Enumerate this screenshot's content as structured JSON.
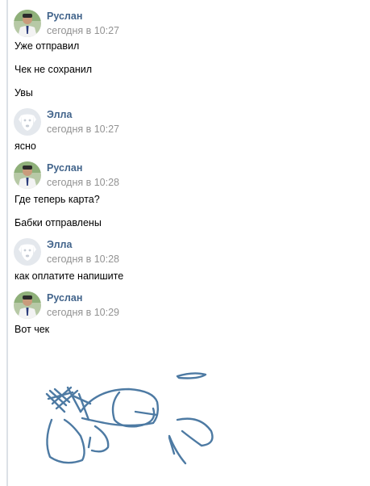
{
  "messages": [
    {
      "author": "Руслан",
      "time": "сегодня в 10:27",
      "avatar": "user-photo",
      "lines": [
        "Уже отправил",
        "Чек не сохранил",
        "Увы"
      ]
    },
    {
      "author": "Элла",
      "time": "сегодня в 10:27",
      "avatar": "deactivated-dog-avatar",
      "lines": [
        "ясно"
      ]
    },
    {
      "author": "Руслан",
      "time": "сегодня в 10:28",
      "avatar": "user-photo",
      "lines": [
        "Где теперь карта?",
        "Бабки отправлены"
      ]
    },
    {
      "author": "Элла",
      "time": "сегодня в 10:28",
      "avatar": "deactivated-dog-avatar",
      "lines": [
        "как оплатите напишите"
      ]
    },
    {
      "author": "Руслан",
      "time": "сегодня в 10:29",
      "avatar": "user-photo",
      "lines": [
        "Вот чек"
      ]
    }
  ],
  "colors": {
    "author_link": "#42648b",
    "timestamp": "#939393",
    "text": "#000000",
    "drawing_stroke": "#4d7aa3"
  }
}
